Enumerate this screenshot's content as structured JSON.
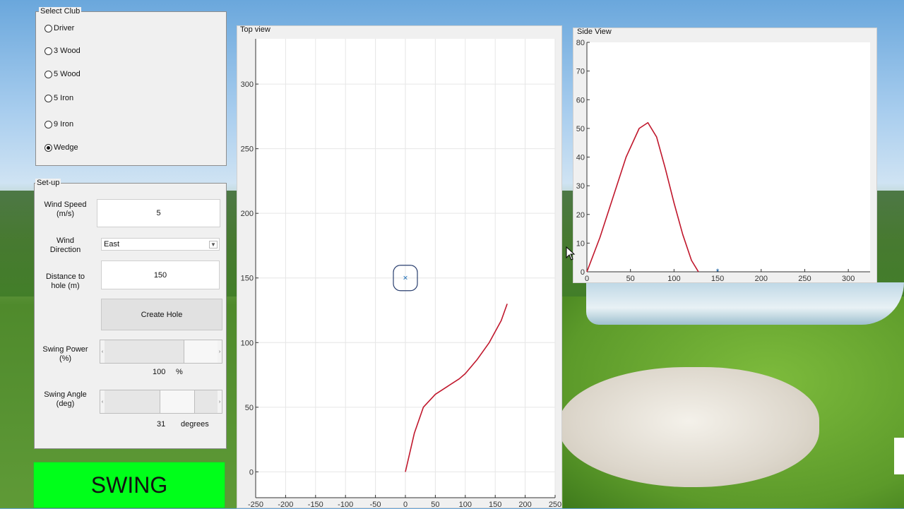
{
  "select_club": {
    "title": "Select Club",
    "options": [
      "Driver",
      "3 Wood",
      "5 Wood",
      "5 Iron",
      "9 Iron",
      "Wedge"
    ],
    "selected": "Wedge"
  },
  "setup": {
    "title": "Set-up",
    "wind_speed_label": "Wind Speed\n(m/s)",
    "wind_speed_value": "5",
    "wind_direction_label": "Wind\nDirection",
    "wind_direction_value": "East",
    "distance_label": "Distance to\nhole (m)",
    "distance_value": "150",
    "create_hole_label": "Create Hole",
    "swing_power_label": "Swing Power\n(%)",
    "swing_power_value": "100",
    "swing_power_unit": "%",
    "swing_power_fraction": 1.0,
    "swing_angle_label": "Swing Angle\n(deg)",
    "swing_angle_value": "31",
    "swing_angle_unit": "degrees",
    "swing_angle_fraction": 0.7
  },
  "swing_button": "SWING",
  "top_view": {
    "title": "Top view",
    "chart_data": {
      "type": "line",
      "xlim": [
        -250,
        250
      ],
      "ylim": [
        -20,
        335
      ],
      "xticks": [
        -250,
        -200,
        -150,
        -100,
        -50,
        0,
        50,
        100,
        150,
        200,
        250
      ],
      "yticks": [
        0,
        50,
        100,
        150,
        200,
        250,
        300
      ],
      "grid": true,
      "trajectory": {
        "color": "#c0172c",
        "x": [
          0,
          15,
          30,
          50,
          70,
          90,
          100,
          120,
          140,
          160,
          170
        ],
        "y": [
          0,
          30,
          50,
          60,
          66,
          72,
          76,
          87,
          100,
          117,
          130
        ]
      },
      "hole_marker": {
        "x": 0,
        "y": 150,
        "symbol": "×",
        "color": "#1f6fb8"
      }
    }
  },
  "side_view": {
    "title": "Side View",
    "chart_data": {
      "type": "line",
      "xlim": [
        0,
        325
      ],
      "ylim": [
        0,
        80
      ],
      "xticks": [
        0,
        50,
        100,
        150,
        200,
        250,
        300
      ],
      "yticks": [
        0,
        10,
        20,
        30,
        40,
        50,
        60,
        70,
        80
      ],
      "grid": false,
      "trajectory": {
        "color": "#c0172c",
        "x": [
          0,
          15,
          30,
          45,
          60,
          70,
          80,
          90,
          100,
          110,
          120,
          128
        ],
        "y": [
          0,
          12,
          26,
          40,
          50,
          52,
          47,
          36,
          24,
          13,
          4,
          0
        ]
      },
      "hole_marker": {
        "x": 150,
        "y": 0,
        "symbol": "*",
        "color": "#1f6fb8"
      }
    }
  }
}
